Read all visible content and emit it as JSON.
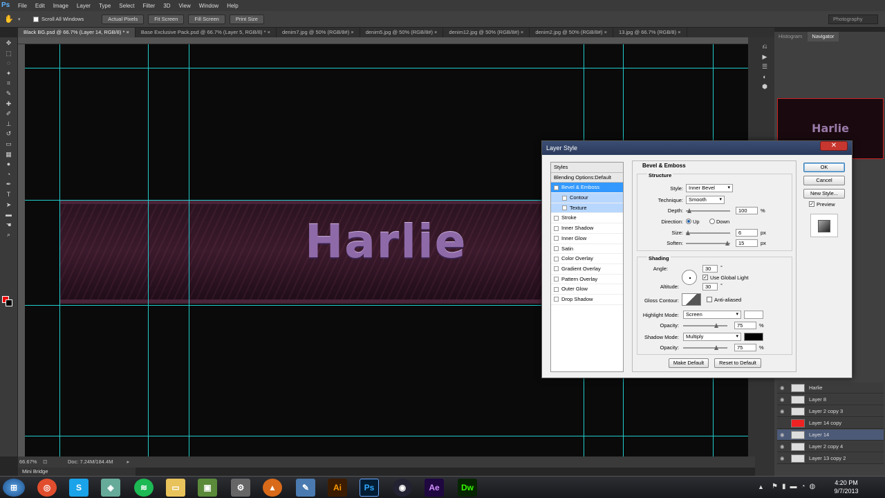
{
  "app": {
    "logo": "Ps",
    "menus": [
      "File",
      "Edit",
      "Image",
      "Layer",
      "Type",
      "Select",
      "Filter",
      "3D",
      "View",
      "Window",
      "Help"
    ],
    "workspace": "Photography"
  },
  "options": {
    "scroll_all": "Scroll All Windows",
    "buttons": [
      "Actual Pixels",
      "Fit Screen",
      "Fill Screen",
      "Print Size"
    ]
  },
  "tabs": [
    "Black BG.psd @ 66.7% (Layer 14, RGB/8) *",
    "Base Exclusive Pack.psd @ 66.7% (Layer 5, RGB/8) *",
    "denim7.jpg @ 50% (RGB/8#)",
    "denim5.jpg @ 50% (RGB/8#)",
    "denim12.jpg @ 50% (RGB/8#)",
    "denim2.jpg @ 50% (RGB/8#)",
    "13.jpg @ 66.7% (RGB/8)"
  ],
  "canvas": {
    "banner_text": "Harlie"
  },
  "status": {
    "zoom": "66.67%",
    "doc": "Doc: 7.24M/184.4M"
  },
  "minibridge": "Mini Bridge",
  "panels": {
    "tabs": [
      "Histogram",
      "Navigator"
    ],
    "nav_text": "Harlie"
  },
  "layers": [
    {
      "name": "Harlie",
      "selected": false
    },
    {
      "name": "Layer 8",
      "selected": false
    },
    {
      "name": "Layer 2 copy 3",
      "selected": false
    },
    {
      "name": "Layer 14 copy",
      "selected": false
    },
    {
      "name": "Layer 14",
      "selected": true
    },
    {
      "name": "Layer 2 copy 4",
      "selected": false
    },
    {
      "name": "Layer 13 copy 2",
      "selected": false
    }
  ],
  "dialog": {
    "title": "Layer Style",
    "close": "✕",
    "styles_header": "Styles",
    "blending": "Blending Options:Default",
    "styles": [
      "Bevel & Emboss",
      "Contour",
      "Texture",
      "Stroke",
      "Inner Shadow",
      "Inner Glow",
      "Satin",
      "Color Overlay",
      "Gradient Overlay",
      "Pattern Overlay",
      "Outer Glow",
      "Drop Shadow"
    ],
    "section": "Bevel & Emboss",
    "structure": "Structure",
    "style_label": "Style:",
    "style_value": "Inner Bevel",
    "technique_label": "Technique:",
    "technique_value": "Smooth",
    "depth_label": "Depth:",
    "depth_value": "100",
    "pct": "%",
    "direction_label": "Direction:",
    "up": "Up",
    "down": "Down",
    "size_label": "Size:",
    "size_value": "6",
    "px": "px",
    "soften_label": "Soften:",
    "soften_value": "15",
    "shading": "Shading",
    "angle_label": "Angle:",
    "angle_value": "30",
    "deg": "°",
    "global_light": "Use Global Light",
    "altitude_label": "Altitude:",
    "altitude_value": "30",
    "gloss_label": "Gloss Contour:",
    "anti_aliased": "Anti-aliased",
    "highlight_label": "Highlight Mode:",
    "highlight_value": "Screen",
    "opacity_label": "Opacity:",
    "highlight_opacity": "75",
    "shadow_label": "Shadow Mode:",
    "shadow_value": "Multiply",
    "shadow_opacity": "75",
    "make_default": "Make Default",
    "reset_default": "Reset to Default",
    "ok": "OK",
    "cancel": "Cancel",
    "new_style": "New Style...",
    "preview": "Preview"
  },
  "taskbar": {
    "time": "4:20 PM",
    "date": "9/7/2013",
    "apps": [
      "Ai",
      "Ps",
      "Ae",
      "Dw"
    ]
  }
}
